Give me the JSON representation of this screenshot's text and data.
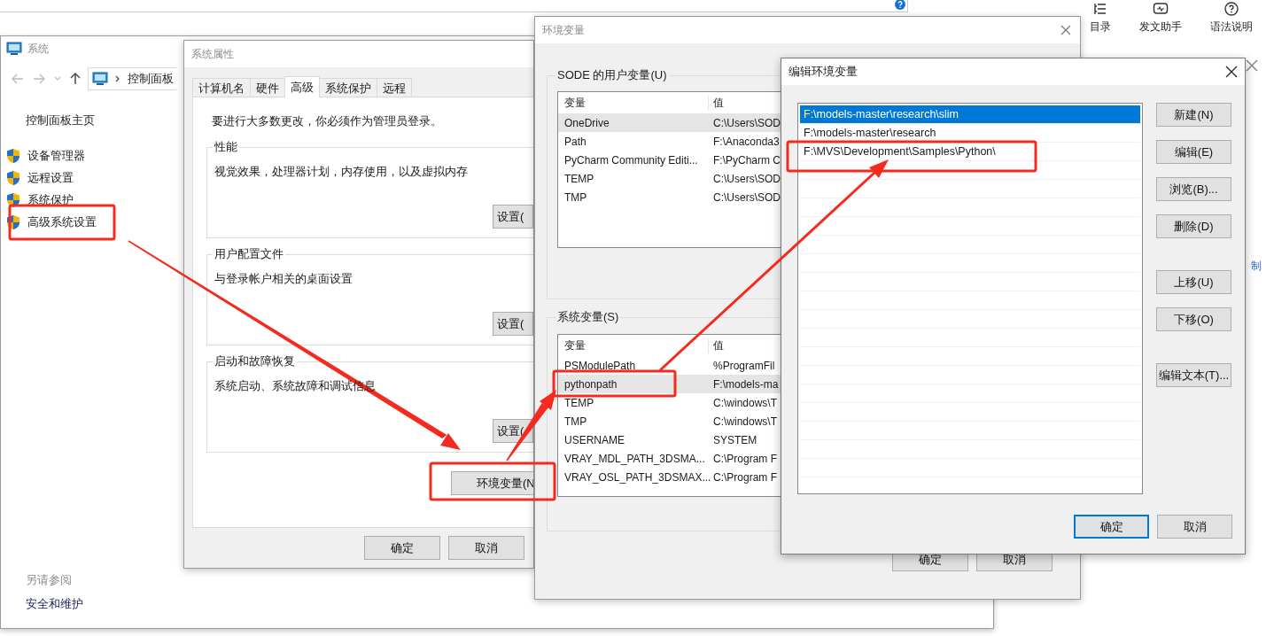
{
  "toolbar": {
    "items": [
      {
        "kind": "toc",
        "label": "目录"
      },
      {
        "kind": "assistant",
        "label": "发文助手"
      },
      {
        "kind": "help",
        "label": "语法说明"
      }
    ]
  },
  "side_link": "制",
  "control_panel": {
    "title": "系统",
    "breadcrumb": "控制面板",
    "home": "控制面板主页",
    "links": [
      {
        "label": "设备管理器"
      },
      {
        "label": "远程设置"
      },
      {
        "label": "系统保护"
      },
      {
        "label": "高级系统设置"
      }
    ],
    "see_also": "另请参阅",
    "see_also_links": [
      "安全和维护"
    ]
  },
  "system_properties": {
    "title": "系统属性",
    "tabs": [
      {
        "label": "计算机名",
        "selected": false
      },
      {
        "label": "硬件",
        "selected": false
      },
      {
        "label": "高级",
        "selected": true
      },
      {
        "label": "系统保护",
        "selected": false
      },
      {
        "label": "远程",
        "selected": false
      }
    ],
    "admin_note": "要进行大多数更改，你必须作为管理员登录。",
    "groups": [
      {
        "title": "性能",
        "description": "视觉效果，处理器计划，内存使用，以及虚拟内存",
        "button": "设置("
      },
      {
        "title": "用户配置文件",
        "description": "与登录帐户相关的桌面设置",
        "button": "设置("
      },
      {
        "title": "启动和故障恢复",
        "description": "系统启动、系统故障和调试信息",
        "button": "设置("
      }
    ],
    "env_button": "环境变量(N",
    "buttons": [
      "确定",
      "取消"
    ]
  },
  "environment_variables": {
    "title": "环境变量",
    "user_vars": {
      "label": "SODE 的用户变量(U)",
      "columns": [
        "变量",
        "值"
      ],
      "rows": [
        {
          "name": "OneDrive",
          "value": "C:\\Users\\SOD",
          "selected": true
        },
        {
          "name": "Path",
          "value": "F:\\Anaconda3",
          "selected": false
        },
        {
          "name": "PyCharm Community Editi...",
          "value": "F:\\PyCharm C",
          "selected": false
        },
        {
          "name": "TEMP",
          "value": "C:\\Users\\SOD",
          "selected": false
        },
        {
          "name": "TMP",
          "value": "C:\\Users\\SOD",
          "selected": false
        }
      ]
    },
    "system_vars": {
      "label": "系统变量(S)",
      "columns": [
        "变量",
        "值"
      ],
      "rows": [
        {
          "name": "PSModulePath",
          "value": "%ProgramFil",
          "selected": false
        },
        {
          "name": "pythonpath",
          "value": "F:\\models-ma",
          "selected": true
        },
        {
          "name": "TEMP",
          "value": "C:\\windows\\T",
          "selected": false
        },
        {
          "name": "TMP",
          "value": "C:\\windows\\T",
          "selected": false
        },
        {
          "name": "USERNAME",
          "value": "SYSTEM",
          "selected": false
        },
        {
          "name": "VRAY_MDL_PATH_3DSMA...",
          "value": "C:\\Program F",
          "selected": false
        },
        {
          "name": "VRAY_OSL_PATH_3DSMAX...",
          "value": "C:\\Program F",
          "selected": false
        }
      ]
    },
    "buttons": [
      "确定",
      "取消"
    ]
  },
  "edit_dialog": {
    "title": "编辑环境变量",
    "entries": [
      {
        "text": "F:\\models-master\\research\\slim",
        "selected": true
      },
      {
        "text": "F:\\models-master\\research",
        "selected": false
      },
      {
        "text": "F:\\MVS\\Development\\Samples\\Python\\",
        "selected": false
      }
    ],
    "side_button_groups": [
      [
        "新建(N)",
        "编辑(E)",
        "浏览(B)...",
        "删除(D)"
      ],
      [
        "上移(U)",
        "下移(O)"
      ],
      [
        "编辑文本(T)..."
      ]
    ],
    "buttons": [
      {
        "label": "确定",
        "default": true
      },
      {
        "label": "取消",
        "default": false
      }
    ]
  }
}
